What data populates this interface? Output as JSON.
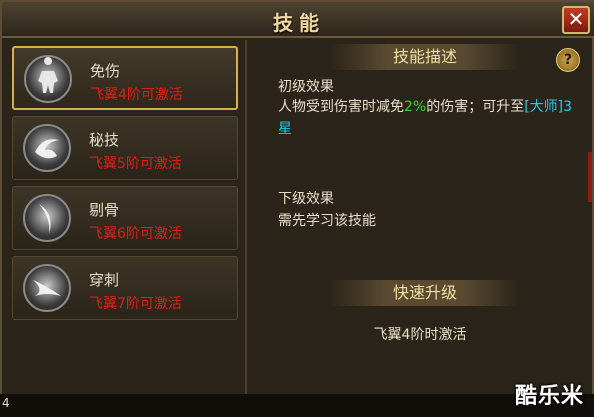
{
  "window": {
    "title": "技能",
    "close_glyph": "✕"
  },
  "skills": [
    {
      "name": "免伤",
      "requirement": "飞翼4阶可激活",
      "icon": "armored-body-icon",
      "selected": true
    },
    {
      "name": "秘技",
      "requirement": "飞翼5阶可激活",
      "icon": "swirl-orb-icon",
      "selected": false
    },
    {
      "name": "剔骨",
      "requirement": "飞翼6阶可激活",
      "icon": "blade-crescent-icon",
      "selected": false
    },
    {
      "name": "穿刺",
      "requirement": "飞翼7阶可激活",
      "icon": "spear-thrust-icon",
      "selected": false
    }
  ],
  "detail": {
    "section_title": "技能描述",
    "help_glyph": "?",
    "first_effect_label": "初级效果",
    "first_effect_pre": "人物受到伤害时减免",
    "first_effect_value": "2%",
    "first_effect_mid": "的伤害；可升至",
    "first_effect_target": "[大师]3星",
    "next_effect_label": "下级效果",
    "next_effect_text": "需先学习该技能",
    "quick_upgrade_title": "快速升级",
    "quick_upgrade_text": "飞翼4阶时激活"
  },
  "footer": {
    "corner_text": "4",
    "watermark": "酷乐米"
  },
  "colors": {
    "accent_gold": "#d7b04e",
    "requirement_red": "#e01f14",
    "value_green": "#37d534",
    "rank_cyan": "#27c8e8",
    "close_red": "#c23a24"
  }
}
